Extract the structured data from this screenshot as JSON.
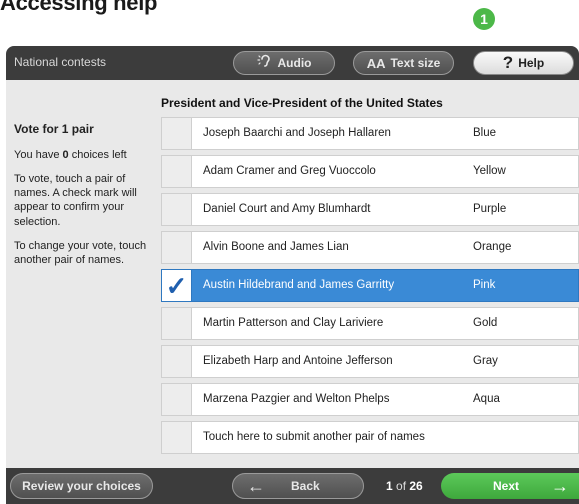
{
  "heading": "Accessing help",
  "step_badge": "1",
  "topbar": {
    "section": "National contests",
    "audio_label": "Audio",
    "audio_icon": "ear-icon",
    "textsize_prefix": "AA",
    "textsize_label": "Text size",
    "help_icon": "?",
    "help_label": "Help"
  },
  "contest": {
    "title": "President and Vice-President of the United States",
    "vote_for": "Vote for 1 pair",
    "choices_prefix": "You have ",
    "choices_count": "0",
    "choices_suffix": " choices left",
    "instructions": "To vote, touch a pair of names. A check mark will appear to confirm your selection.",
    "change_instructions": "To change your vote, touch another pair of names."
  },
  "candidates": [
    {
      "name": "Joseph Baarchi and Joseph Hallaren",
      "party": "Blue",
      "selected": false
    },
    {
      "name": "Adam Cramer and Greg Vuoccolo",
      "party": "Yellow",
      "selected": false
    },
    {
      "name": "Daniel Court and Amy Blumhardt",
      "party": "Purple",
      "selected": false
    },
    {
      "name": "Alvin Boone and James Lian",
      "party": "Orange",
      "selected": false
    },
    {
      "name": "Austin Hildebrand and James Garritty",
      "party": "Pink",
      "selected": true
    },
    {
      "name": "Martin Patterson and Clay Lariviere",
      "party": "Gold",
      "selected": false
    },
    {
      "name": "Elizabeth Harp and Antoine Jefferson",
      "party": "Gray",
      "selected": false
    },
    {
      "name": "Marzena Pazgier and Welton Phelps",
      "party": "Aqua",
      "selected": false
    }
  ],
  "write_in": "Touch here to submit another pair of names",
  "bottombar": {
    "review_label": "Review your choices",
    "back_label": "Back",
    "page_current": "1",
    "page_of": " of ",
    "page_total": "26",
    "next_label": "Next"
  },
  "colors": {
    "selected": "#3a8ad6",
    "next_button": "#4cb848",
    "bar": "#3c3c3c",
    "panel": "#e9e9e9"
  }
}
